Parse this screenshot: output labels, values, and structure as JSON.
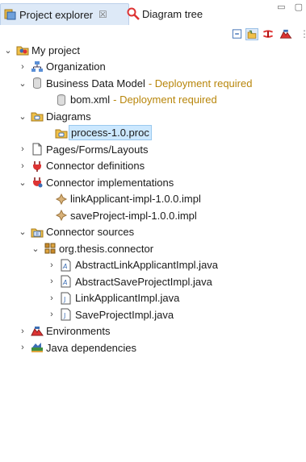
{
  "tabs": {
    "explorer_label": "Project explorer",
    "explorer_close": "☒",
    "tree_label": "Diagram tree"
  },
  "tree": {
    "root": "My project",
    "organization": "Organization",
    "bdm": "Business Data Model",
    "bdm_status": "- Deployment required",
    "bom": "bom.xml",
    "bom_status": "- Deployment required",
    "diagrams": "Diagrams",
    "process": "process-1.0.proc",
    "pages": "Pages/Forms/Layouts",
    "connector_defs": "Connector definitions",
    "connector_impls": "Connector implementations",
    "impl1": "linkApplicant-impl-1.0.0.impl",
    "impl2": "saveProject-impl-1.0.0.impl",
    "connector_sources": "Connector sources",
    "package": "org.thesis.connector",
    "file1": "AbstractLinkApplicantImpl.java",
    "file2": "AbstractSaveProjectImpl.java",
    "file3": "LinkApplicantImpl.java",
    "file4": "SaveProjectImpl.java",
    "environments": "Environments",
    "java_deps": "Java dependencies"
  },
  "colors": {
    "selection": "#cce8ff",
    "decoration": "#b8860b",
    "tab_active": "#dde9f7"
  }
}
